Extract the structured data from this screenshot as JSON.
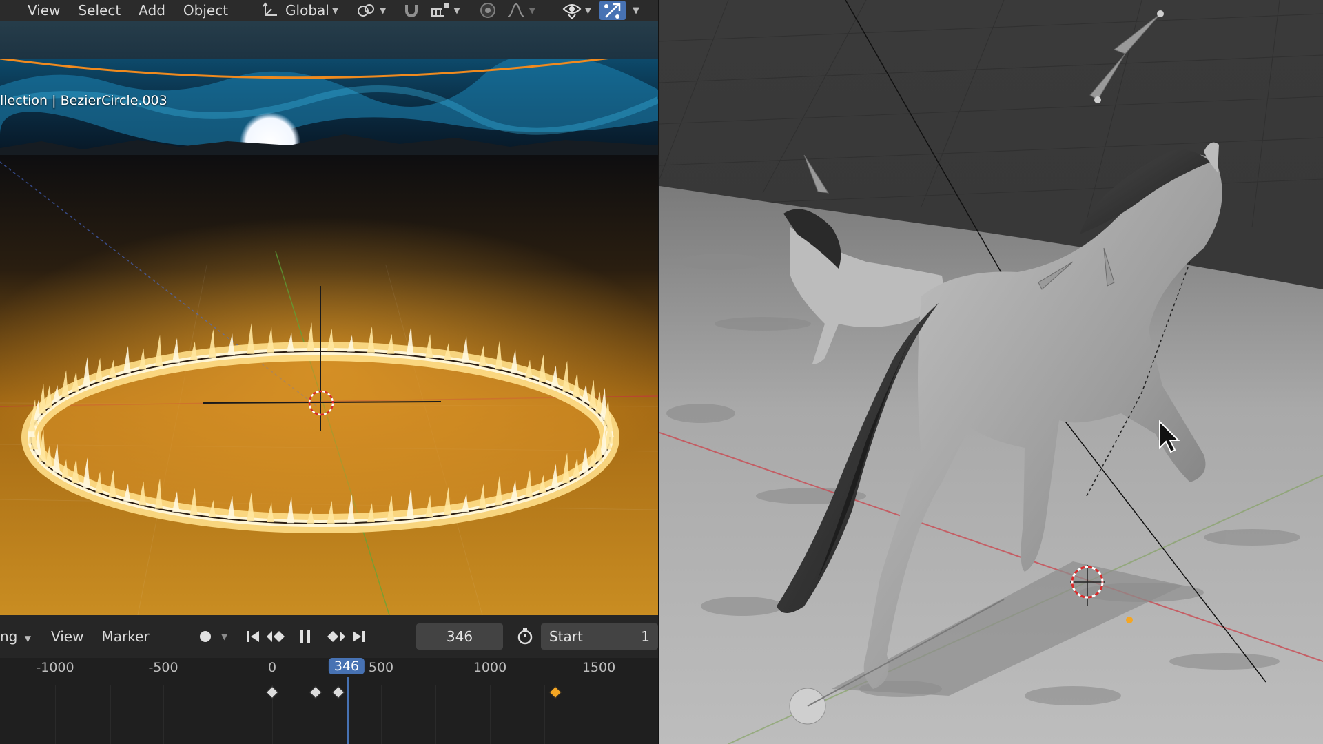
{
  "viewport_header": {
    "menus": [
      "View",
      "Select",
      "Add",
      "Object"
    ],
    "orientation_label": "Global"
  },
  "viewport_overlay": {
    "collection_text": "llection | BezierCircle.003"
  },
  "timeline": {
    "mode_label": "ng",
    "menus": [
      "View",
      "Marker"
    ],
    "current_frame": "346",
    "start_label": "Start",
    "start_value": "1",
    "ruler_ticks": [
      "-1000",
      "-500",
      "0",
      "500",
      "1000",
      "1500"
    ],
    "keyframes": [
      0,
      200,
      305,
      1300
    ],
    "selected_keyframe": 1300
  },
  "colors": {
    "accent": "#4772b3",
    "selected_keyframe": "#f5a623",
    "keyframe": "#dcdcdc",
    "curve": "#f08a1e",
    "fire": "#ffcc55"
  }
}
